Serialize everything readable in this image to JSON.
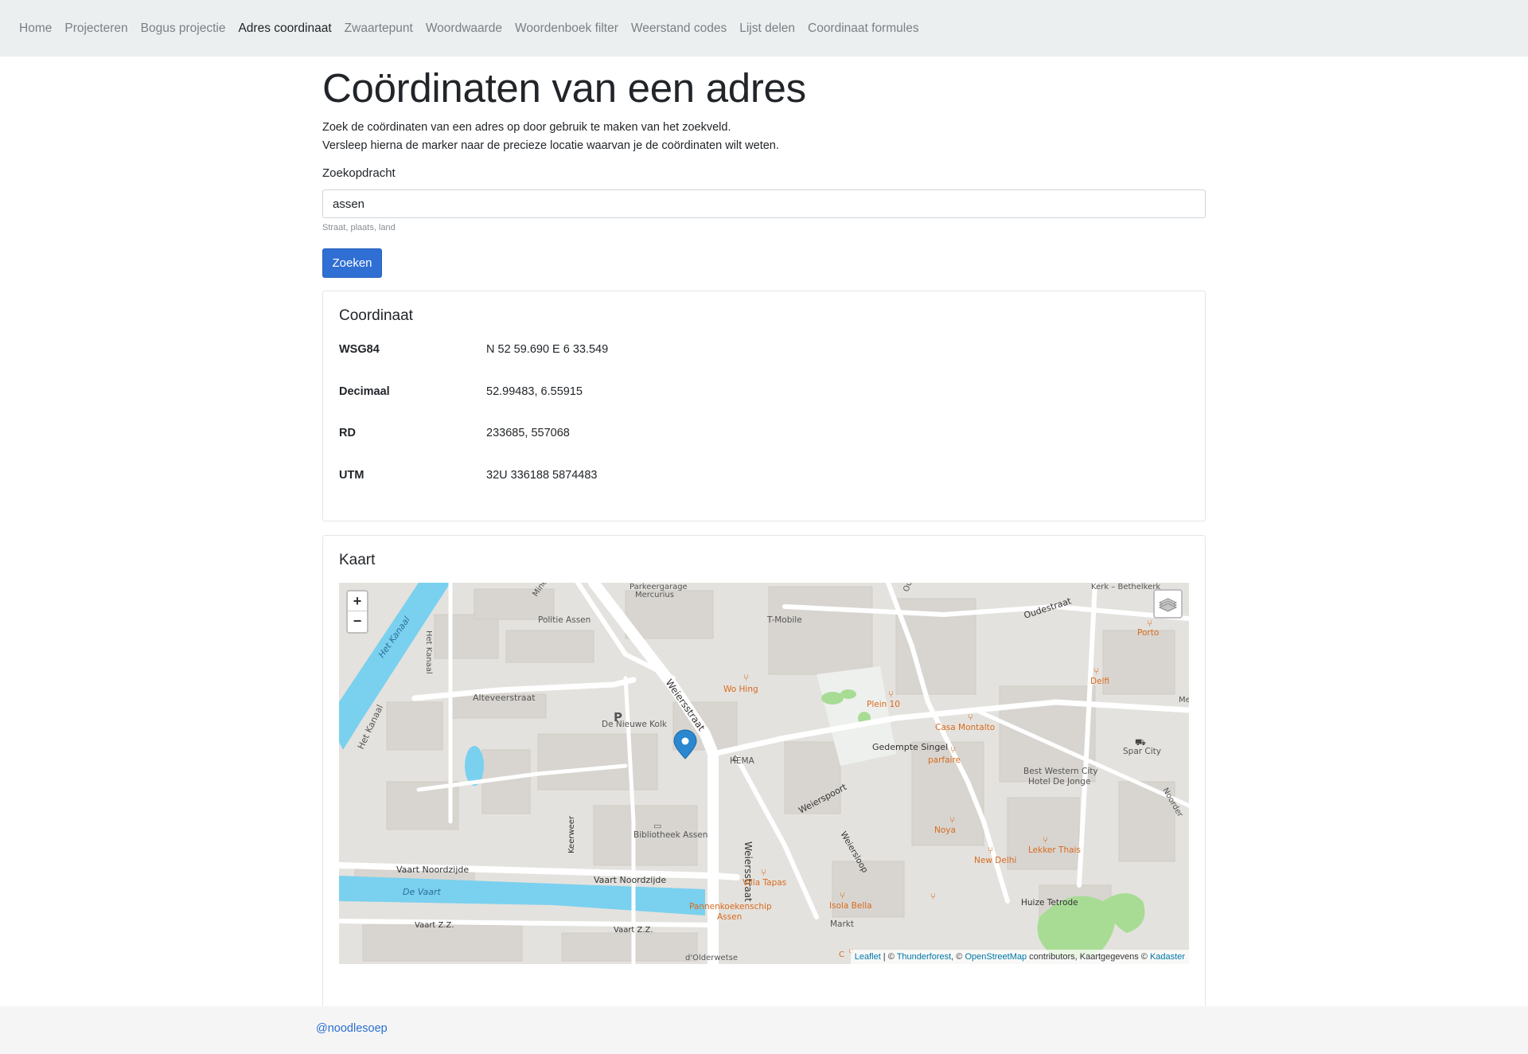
{
  "nav": {
    "items": [
      {
        "label": "Home"
      },
      {
        "label": "Projecteren"
      },
      {
        "label": "Bogus projectie"
      },
      {
        "label": "Adres coordinaat",
        "active": true
      },
      {
        "label": "Zwaartepunt"
      },
      {
        "label": "Woordwaarde"
      },
      {
        "label": "Woordenboek filter"
      },
      {
        "label": "Weerstand codes"
      },
      {
        "label": "Lijst delen"
      },
      {
        "label": "Coordinaat formules"
      }
    ]
  },
  "page": {
    "title": "Coördinaten van een adres",
    "intro_line1": "Zoek de coördinaten van een adres op door gebruik te maken van het zoekveld.",
    "intro_line2": "Versleep hierna de marker naar de precieze locatie waarvan je de coördinaten wilt weten."
  },
  "search": {
    "label": "Zoekopdracht",
    "value": "assen",
    "hint": "Straat, plaats, land",
    "button": "Zoeken"
  },
  "coordinate": {
    "title": "Coordinaat",
    "rows": [
      {
        "label": "WSG84",
        "value": "N 52 59.690 E 6 33.549"
      },
      {
        "label": "Decimaal",
        "value": "52.99483, 6.55915"
      },
      {
        "label": "RD",
        "value": "233685, 557068"
      },
      {
        "label": "UTM",
        "value": "32U 336188 5874483"
      }
    ]
  },
  "map": {
    "title": "Kaart",
    "zoom_in": "+",
    "zoom_out": "−",
    "attribution": {
      "leaflet": "Leaflet",
      "sep1": " | © ",
      "thunderforest": "Thunderforest",
      "sep2": ", © ",
      "osm": "OpenStreetMap",
      "sep3": " contributors, Kaartgegevens © ",
      "kadaster": "Kadaster"
    },
    "labels": {
      "het_kanaal_1": "Het Kanaal",
      "het_kanaal_2": "Het Kanaal",
      "het_kanaal_3": "Het Kanaal",
      "alteveerstraat": "Alteveerstraat",
      "politie": "Politie Assen",
      "parkeergarage": "Parkeergarage",
      "mercurius": "Mercurius",
      "tmobile": "T-Mobile",
      "weiersstraat_1": "Weiersstraat",
      "weiersstraat_2": "Weiersstraat",
      "wo_hing": "Wo Hing",
      "plein10": "Plein 10",
      "casa": "Casa Montalto",
      "gedempte": "Gedempte Singel",
      "parfaire": "parfaire",
      "hema": "HEMA",
      "nieuwe_kolk": "De Nieuwe Kolk",
      "parking_p": "P",
      "bibliotheek": "Bibliotheek Assen",
      "weierspoort": "Weierspoort",
      "weiersloop": "Weiersloop",
      "keerweer": "Keerweer",
      "vaart_noord_1": "Vaart Noordzijde",
      "vaart_noord_2": "Vaart Noordzijde",
      "de_vaart": "De Vaart",
      "villa_tapas": "Villa Tapas",
      "pannenkoek_1": "Pannenkoekenschip",
      "pannenkoek_2": "Assen",
      "vaart_zz_1": "Vaart Z.Z.",
      "vaart_zz_2": "Vaart Z.Z.",
      "olderwetse": "d'Olderwetse",
      "isola": "Isola Bella",
      "markt": "Markt",
      "noya": "Noya",
      "new_delhi": "New Delhi",
      "lekker_thais": "Lekker Thais",
      "huize": "Huize Tetrode",
      "best_western_1": "Best Western City",
      "best_western_2": "Hotel De Jonge",
      "spar": "Spar City",
      "porto": "Porto",
      "delfi": "Delfi",
      "oudestraat": "Oudestraat",
      "kerk": "Kerk – Bethelkerk",
      "minerva": "Minerva",
      "ou": "Ou",
      "noorder": "Noorder",
      "me": "Me",
      "c": "C"
    }
  },
  "footer": {
    "link": "@noodlesoep"
  },
  "colors": {
    "nav_bg": "#eceff0",
    "primary": "#2f6fd4",
    "water": "#7ad0ef",
    "marker": "#2a87d0",
    "poi_orange": "#d86a1e",
    "park": "#a8dc95"
  }
}
